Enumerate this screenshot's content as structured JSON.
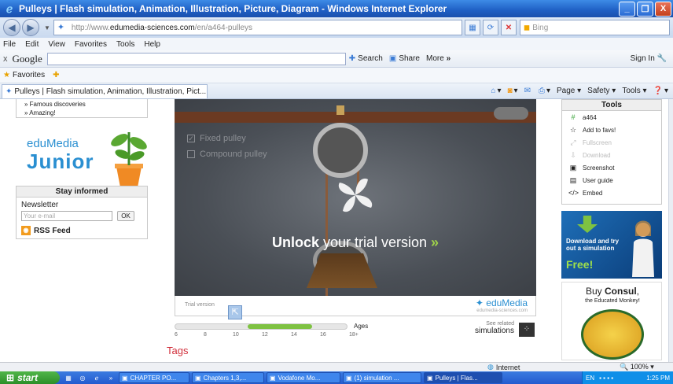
{
  "window": {
    "title": "Pulleys | Flash simulation, Animation, Illustration, Picture, Diagram - Windows Internet Explorer",
    "minimize": "_",
    "maximize": "❐",
    "close": "X"
  },
  "address": {
    "url_prefix": "http://www.",
    "host": "edumedia-sciences.com",
    "path": "/en/a464-pulleys",
    "search_placeholder": "Bing"
  },
  "menu": [
    "File",
    "Edit",
    "View",
    "Favorites",
    "Tools",
    "Help"
  ],
  "google_toolbar": {
    "close": "x",
    "logo": "Google",
    "search": "Search",
    "share": "Share",
    "more": "More",
    "more_arrow": "»",
    "sign_in": "Sign In"
  },
  "favorites": {
    "label": "Favorites"
  },
  "tab": {
    "title": "Pulleys | Flash simulation, Animation, Illustration, Pict..."
  },
  "commands": {
    "page": "Page",
    "safety": "Safety",
    "tools": "Tools"
  },
  "left": {
    "links": [
      "Famous discoveries",
      "Amazing!"
    ],
    "junior_edu": "eduMedia",
    "junior_word": "Junior",
    "stay_informed": "Stay informed",
    "newsletter": "Newsletter",
    "email_placeholder": "Your e-mail",
    "ok": "OK",
    "rss": "RSS Feed"
  },
  "simulation": {
    "opt_fixed": "Fixed pulley",
    "opt_compound": "Compound pulley",
    "unlock_bold": "Unlock",
    "unlock_rest": " your trial version ",
    "unlock_arrow": "»",
    "trial_version": "Trial version",
    "logo": "eduMedia",
    "logo_url": "edumedia-sciences.com"
  },
  "ages": {
    "label": "Ages",
    "ticks": [
      "6",
      "8",
      "10",
      "12",
      "14",
      "16",
      "18+"
    ],
    "range_fraction": [
      0.42,
      0.8
    ]
  },
  "related": {
    "see": "See related",
    "simulations": "simulations"
  },
  "tags_heading": "Tags",
  "tools_panel": {
    "title": "Tools",
    "items": [
      {
        "icon": "#",
        "label": "a464",
        "enabled": true
      },
      {
        "icon": "☆",
        "label": "Add to favs!",
        "enabled": true
      },
      {
        "icon": "⤢",
        "label": "Fullscreen",
        "enabled": false
      },
      {
        "icon": "⇩",
        "label": "Download",
        "enabled": false
      },
      {
        "icon": "▣",
        "label": "Screenshot",
        "enabled": true
      },
      {
        "icon": "▤",
        "label": "User guide",
        "enabled": true
      },
      {
        "icon": "</>",
        "label": "Embed",
        "enabled": true
      }
    ]
  },
  "ad_trial": {
    "text": "Download and try out a simulation",
    "free": "Free!"
  },
  "ad_consul": {
    "buy": "Buy ",
    "consul": "Consul",
    "comma": ",",
    "tagline": "the Educated Monkey!"
  },
  "status": {
    "zone": "Internet",
    "zoom": "100%"
  },
  "taskbar": {
    "start": "start",
    "tasks": [
      {
        "label": "CHAPTER PO...",
        "active": false
      },
      {
        "label": "Chapters 1,3,...",
        "active": false
      },
      {
        "label": "Vodafone Mo...",
        "active": false
      },
      {
        "label": "(1) simulation ...",
        "active": false
      },
      {
        "label": "Pulleys | Flas...",
        "active": true
      }
    ],
    "lang": "EN",
    "clock": "1:25 PM"
  },
  "colors": {
    "accent": "#2a8fd1",
    "tags": "#d12f3b",
    "age_fill": "#7ec242"
  }
}
